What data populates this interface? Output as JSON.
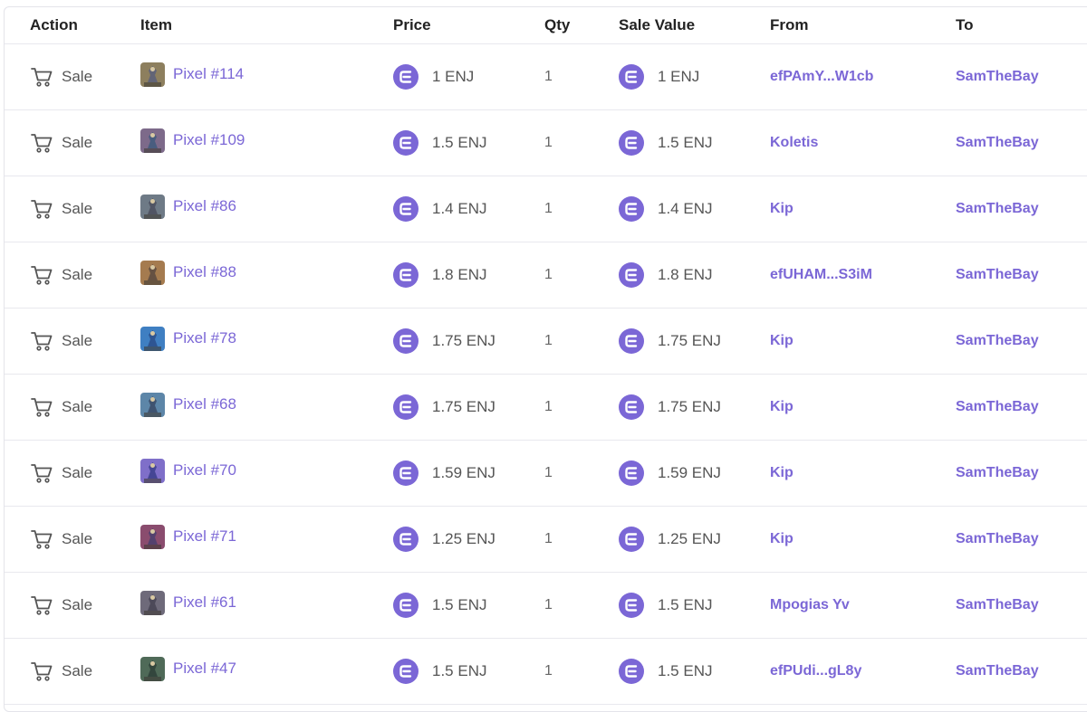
{
  "headers": {
    "action": "Action",
    "item": "Item",
    "price": "Price",
    "qty": "Qty",
    "sale_value": "Sale Value",
    "from": "From",
    "to": "To"
  },
  "colors": {
    "accent": "#7b67d6",
    "enj_icon": "#7b67d6",
    "text_muted": "#555555"
  },
  "rows": [
    {
      "action": "Sale",
      "item": "Pixel #114",
      "price": "1 ENJ",
      "qty": "1",
      "sale_value": "1 ENJ",
      "from": "efPAmY...W1cb",
      "to": "SamTheBay"
    },
    {
      "action": "Sale",
      "item": "Pixel #109",
      "price": "1.5 ENJ",
      "qty": "1",
      "sale_value": "1.5 ENJ",
      "from": "Koletis",
      "to": "SamTheBay"
    },
    {
      "action": "Sale",
      "item": "Pixel #86",
      "price": "1.4 ENJ",
      "qty": "1",
      "sale_value": "1.4 ENJ",
      "from": "Kip",
      "to": "SamTheBay"
    },
    {
      "action": "Sale",
      "item": "Pixel #88",
      "price": "1.8 ENJ",
      "qty": "1",
      "sale_value": "1.8 ENJ",
      "from": "efUHAM...S3iM",
      "to": "SamTheBay"
    },
    {
      "action": "Sale",
      "item": "Pixel #78",
      "price": "1.75 ENJ",
      "qty": "1",
      "sale_value": "1.75 ENJ",
      "from": "Kip",
      "to": "SamTheBay"
    },
    {
      "action": "Sale",
      "item": "Pixel #68",
      "price": "1.75 ENJ",
      "qty": "1",
      "sale_value": "1.75 ENJ",
      "from": "Kip",
      "to": "SamTheBay"
    },
    {
      "action": "Sale",
      "item": "Pixel #70",
      "price": "1.59 ENJ",
      "qty": "1",
      "sale_value": "1.59 ENJ",
      "from": "Kip",
      "to": "SamTheBay"
    },
    {
      "action": "Sale",
      "item": "Pixel #71",
      "price": "1.25 ENJ",
      "qty": "1",
      "sale_value": "1.25 ENJ",
      "from": "Kip",
      "to": "SamTheBay"
    },
    {
      "action": "Sale",
      "item": "Pixel #61",
      "price": "1.5 ENJ",
      "qty": "1",
      "sale_value": "1.5 ENJ",
      "from": "Mpogias Yv",
      "to": "SamTheBay"
    },
    {
      "action": "Sale",
      "item": "Pixel #47",
      "price": "1.5 ENJ",
      "qty": "1",
      "sale_value": "1.5 ENJ",
      "from": "efPUdi...gL8y",
      "to": "SamTheBay"
    }
  ]
}
